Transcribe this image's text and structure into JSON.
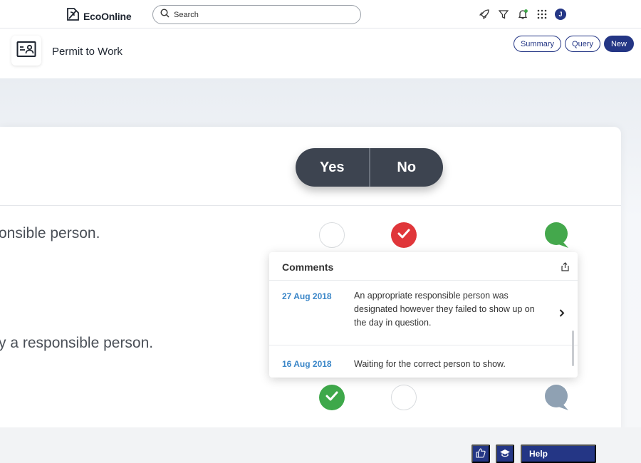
{
  "app": {
    "brand": "EcoOnline"
  },
  "search": {
    "placeholder": "Search"
  },
  "topbar": {
    "user_initial": "J"
  },
  "header": {
    "module_title": "Permit to Work"
  },
  "actions": {
    "summary": "Summary",
    "query": "Query",
    "new": "New"
  },
  "illustration": {
    "toggle_yes": "Yes",
    "toggle_no": "No",
    "question_1": "onsible person.",
    "question_2": "y a responsible person."
  },
  "comments": {
    "title": "Comments",
    "items": [
      {
        "date": "27 Aug 2018",
        "text": "An appropriate responsible person was designated however they failed to show up on the day in question."
      },
      {
        "date": "16 Aug 2018",
        "text": "Waiting for the correct person to show."
      }
    ]
  },
  "footer": {
    "help_label": "Help"
  },
  "colors": {
    "brand": "#243685",
    "yes_red": "#e0363a",
    "yes_green": "#3ea84a",
    "comment_green": "#44a84c",
    "comment_grey": "#8fa1b3",
    "date_blue": "#3a86c8"
  }
}
